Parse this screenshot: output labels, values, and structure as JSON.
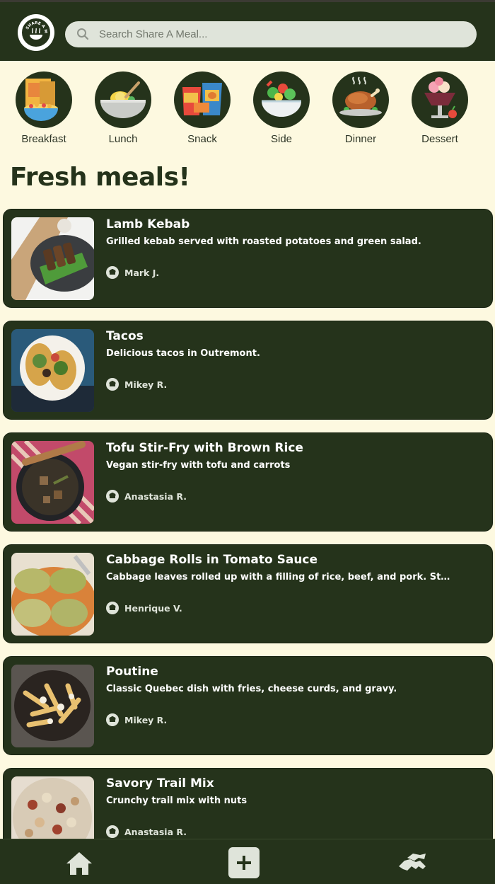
{
  "app": {
    "logo_text": "SHARE A MEAL"
  },
  "search": {
    "placeholder": "Search Share A Meal...",
    "value": ""
  },
  "categories": [
    {
      "label": "Breakfast",
      "icon": "cereal-box-icon"
    },
    {
      "label": "Lunch",
      "icon": "noodle-bowl-icon"
    },
    {
      "label": "Snack",
      "icon": "chips-bag-icon"
    },
    {
      "label": "Side",
      "icon": "salad-bowl-icon"
    },
    {
      "label": "Dinner",
      "icon": "roast-turkey-icon"
    },
    {
      "label": "Dessert",
      "icon": "ice-cream-sundae-icon"
    }
  ],
  "section_title": "Fresh meals!",
  "meals": [
    {
      "title": "Lamb Kebab",
      "description": "Grilled kebab served with roasted potatoes and green salad.",
      "author": "Mark J."
    },
    {
      "title": "Tacos",
      "description": "Delicious tacos in Outremont.",
      "author": "Mikey R."
    },
    {
      "title": "Tofu Stir-Fry with Brown Rice",
      "description": "Vegan stir-fry with tofu and carrots",
      "author": "Anastasia R."
    },
    {
      "title": "Cabbage Rolls in Tomato Sauce",
      "description": "Cabbage leaves rolled up with a filling of rice, beef, and pork. Stewed in to...",
      "author": "Henrique V."
    },
    {
      "title": "Poutine",
      "description": "Classic Quebec dish with fries, cheese curds, and gravy.",
      "author": "Mikey R."
    },
    {
      "title": "Savory Trail Mix",
      "description": "Crunchy trail mix with nuts",
      "author": "Anastasia R."
    }
  ],
  "nav": {
    "home_icon": "home-icon",
    "add_icon": "plus-icon",
    "share_icon": "handshake-icon"
  },
  "colors": {
    "primary": "#25331b",
    "background": "#fdf9e0",
    "accent_light": "#dfe4da"
  }
}
